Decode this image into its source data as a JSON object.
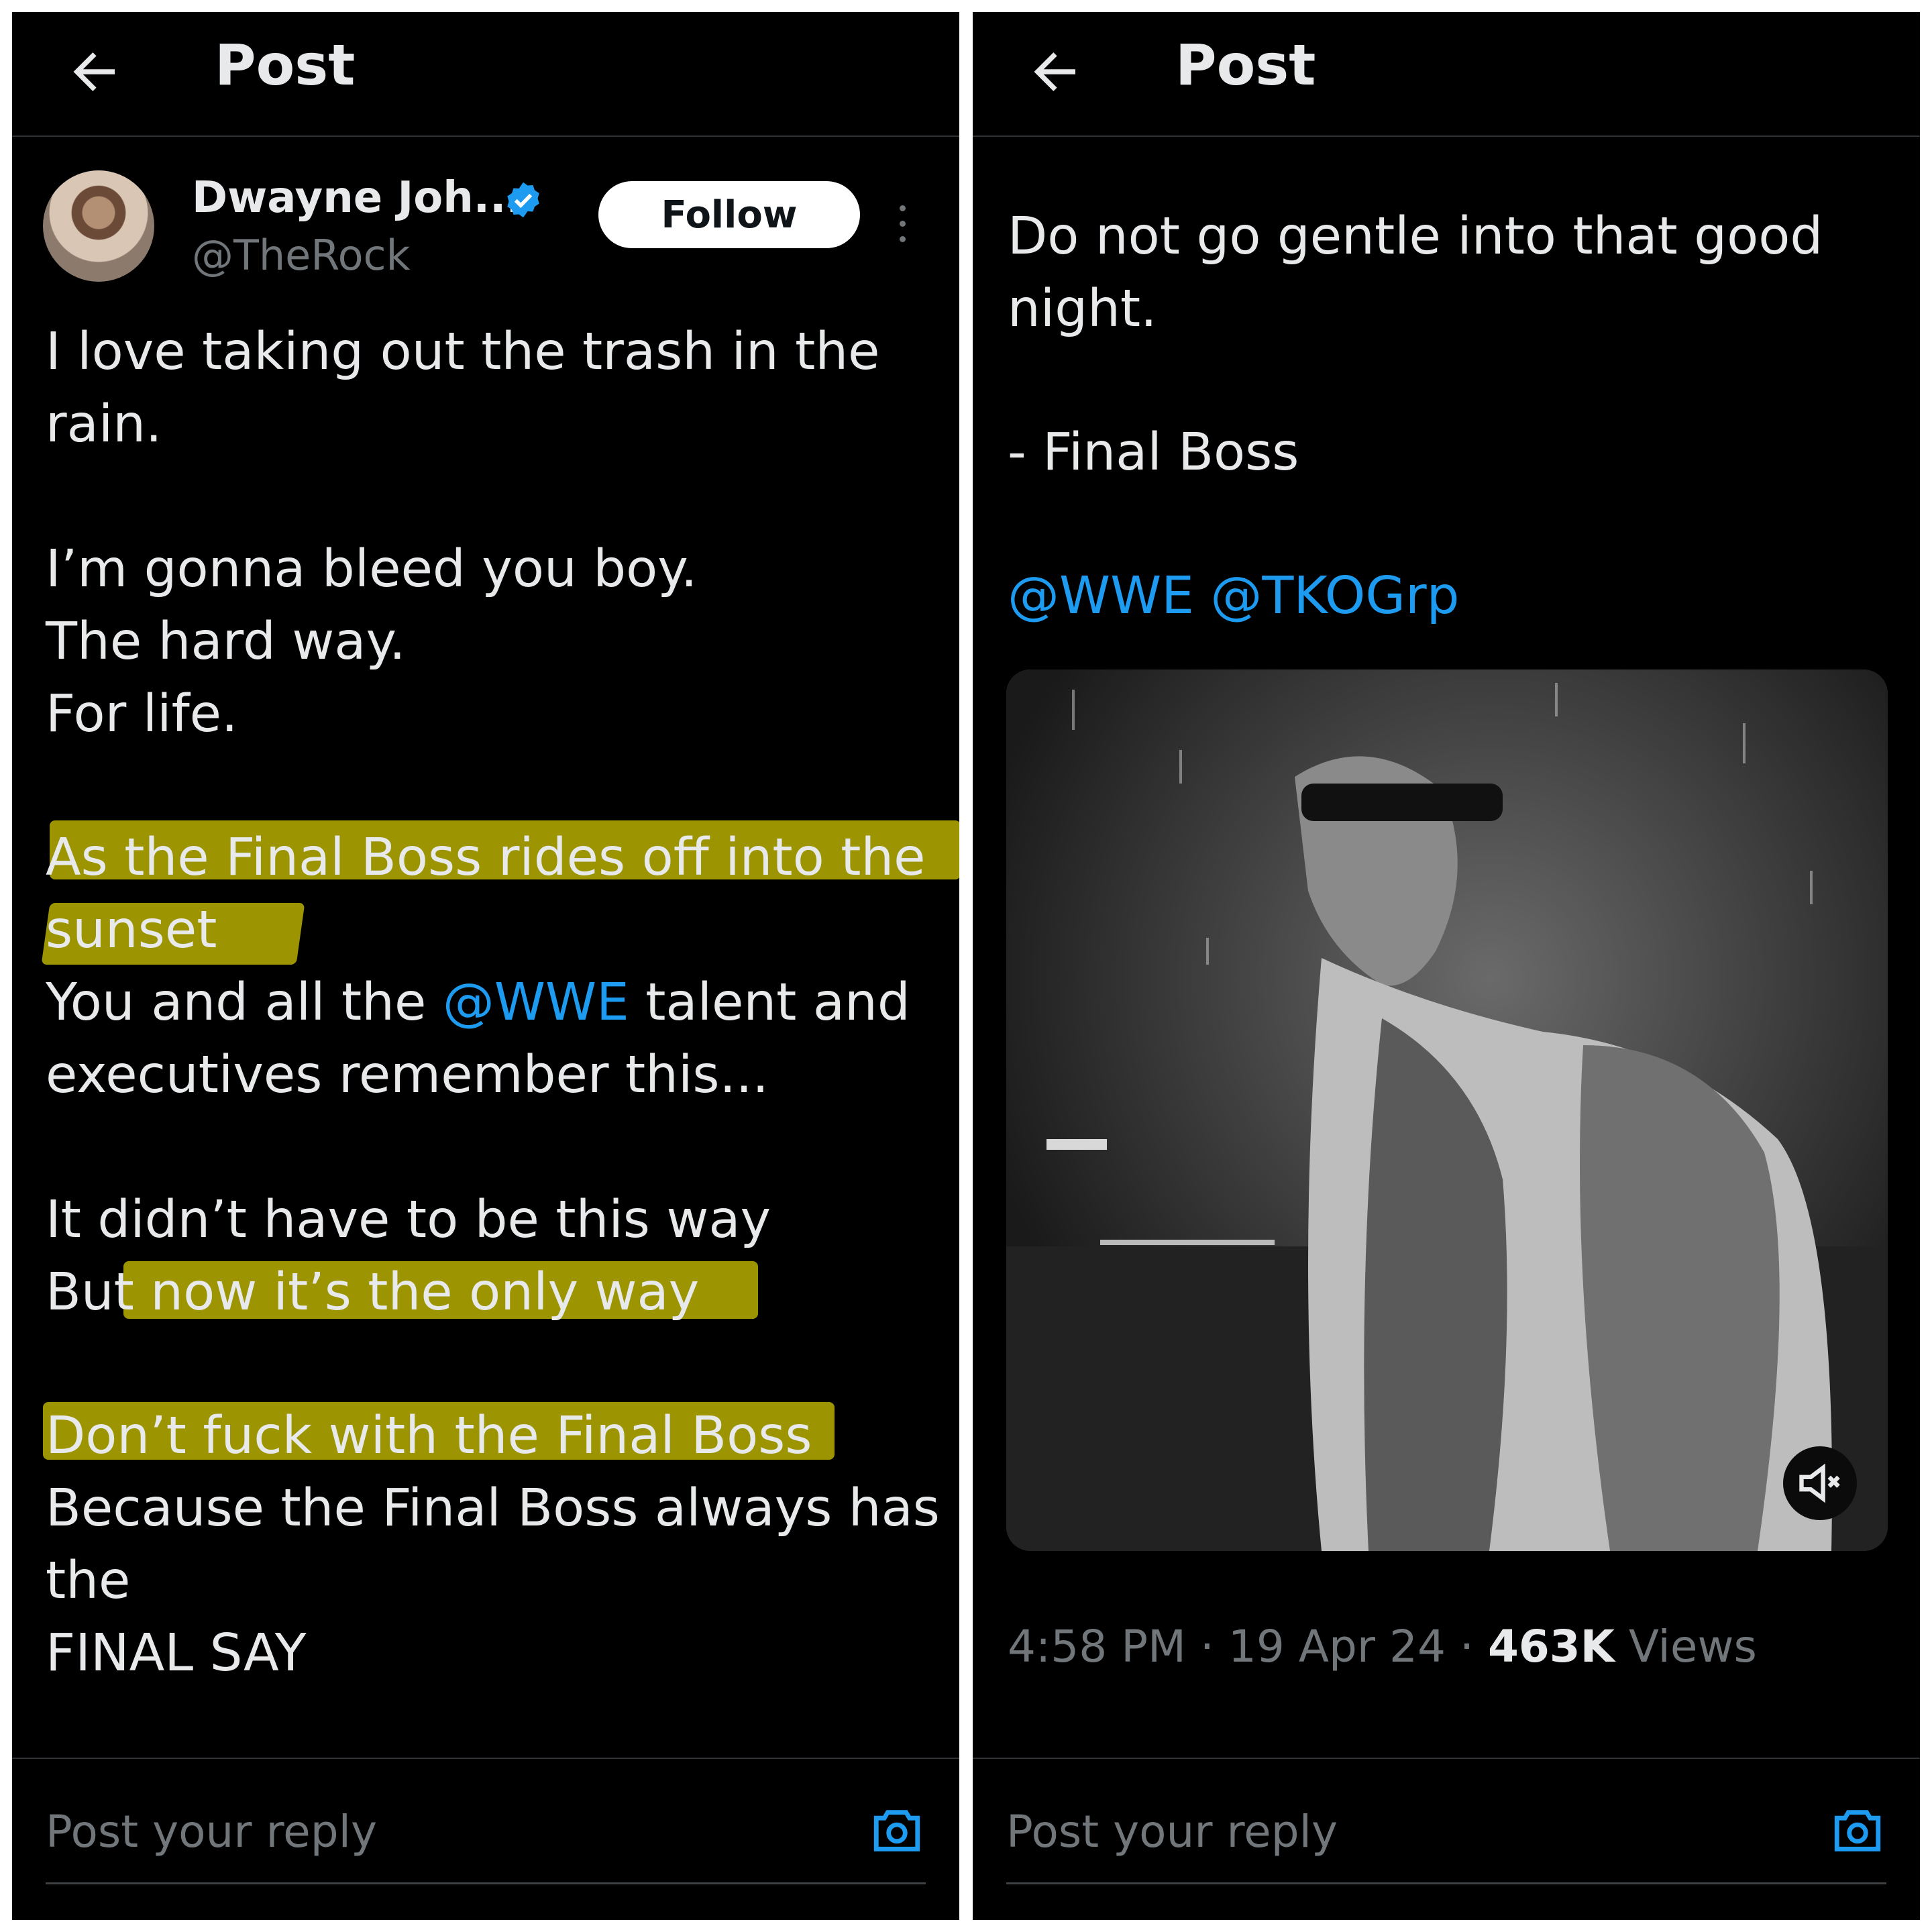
{
  "left": {
    "header": {
      "title": "Post"
    },
    "author": {
      "name": "Dwayne Joh...",
      "handle": "@TheRock"
    },
    "follow_label": "Follow",
    "lines": {
      "l1": "I love taking out the trash in the",
      "l2": "rain.",
      "l3": "I’m gonna bleed you boy.",
      "l4": "The hard way.",
      "l5": "For life.",
      "l6": "As the Final Boss rides off into the",
      "l7": "sunset",
      "l8a": "You and all the ",
      "l8m": "@WWE",
      "l8b": " talent and",
      "l9": "executives remember this...",
      "l10": "It didn’t have to be this way",
      "l11": "But now it’s the only way",
      "l12": "Don’t fuck with the Final Boss",
      "l13": "Because the Final Boss always has",
      "l14": "the",
      "l15": "FINAL SAY"
    },
    "reply_placeholder": "Post your reply"
  },
  "right": {
    "header": {
      "title": "Post"
    },
    "lines": {
      "r1": "Do not go gentle into that good",
      "r2": "night.",
      "r3": "- Final Boss",
      "mentions": "@WWE @TKOGrp"
    },
    "meta": {
      "time": "4:58 PM",
      "sep1": " · ",
      "date": "19 Apr 24",
      "sep2": " · ",
      "views_count": "463K",
      "views_label": " Views"
    },
    "reply_placeholder": "Post your reply"
  },
  "colors": {
    "accent": "#1d9bf0",
    "background": "#000000",
    "text": "#e7e9ea",
    "muted": "#71767b",
    "highlight": "#c8be00"
  },
  "icons": [
    "back-arrow-icon",
    "verified-badge-icon",
    "more-options-icon",
    "camera-icon",
    "mute-icon"
  ]
}
